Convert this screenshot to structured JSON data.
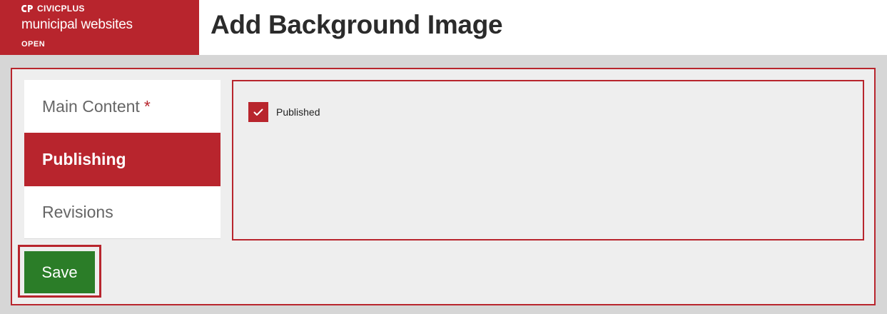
{
  "brand": {
    "company": "CIVICPLUS",
    "product": "municipal websites",
    "badge": "OPEN",
    "logo_icon": "civicplus-logo-icon",
    "color": "#b8252d"
  },
  "page": {
    "title": "Add Background Image"
  },
  "tabs": [
    {
      "label": "Main Content",
      "required_marker": "*",
      "active": false
    },
    {
      "label": "Publishing",
      "active": true
    },
    {
      "label": "Revisions",
      "active": false
    }
  ],
  "publishing": {
    "published_label": "Published",
    "published_checked": true,
    "check_icon": "checkmark-icon"
  },
  "actions": {
    "save_label": "Save",
    "save_color": "#2b7d28"
  }
}
